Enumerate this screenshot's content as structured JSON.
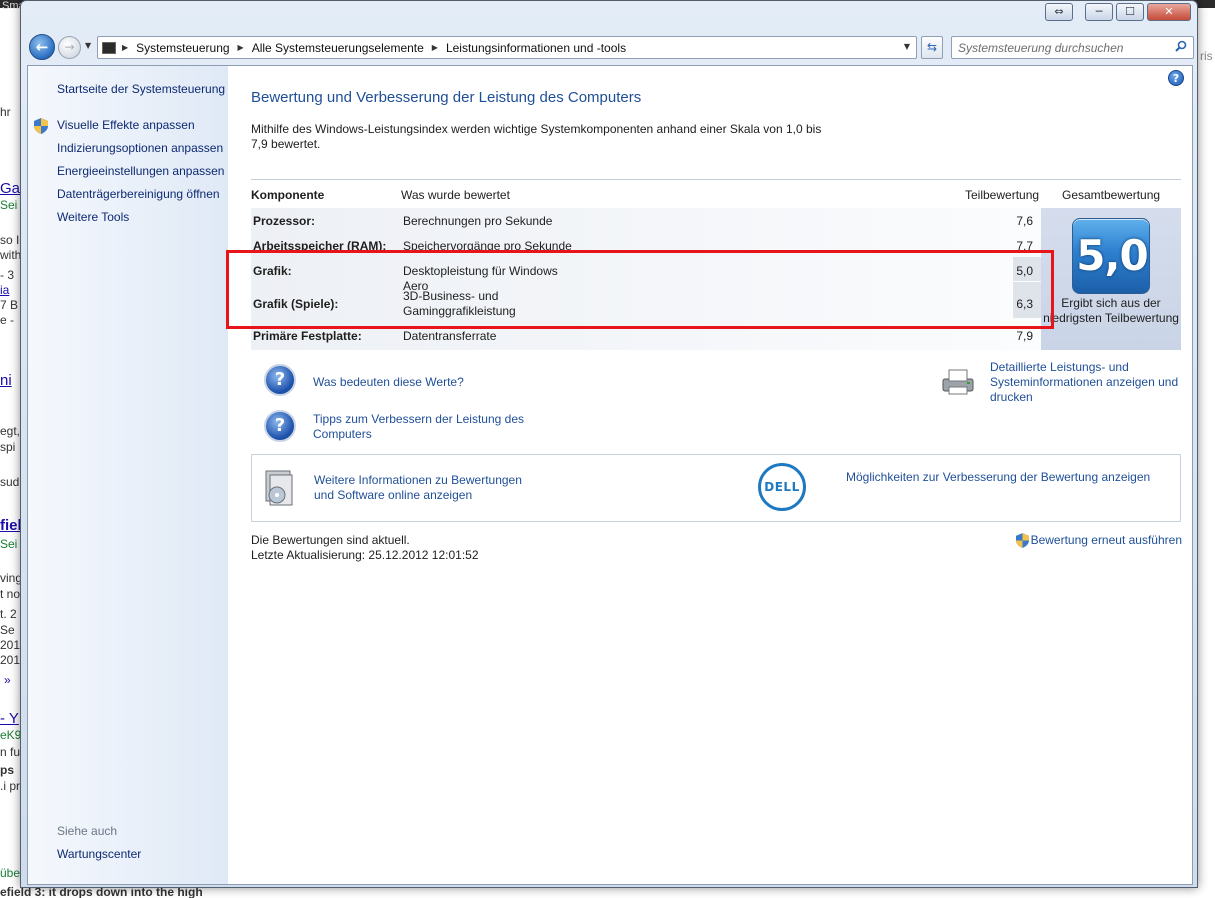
{
  "background_page": {
    "fragments": [
      "hr",
      "Ga",
      "Sei",
      "so I'",
      "with",
      "- 3",
      "ia",
      "7 B",
      "e -",
      "ni",
      "egt,",
      "spi",
      "sud",
      "fiel",
      "Sei",
      "ving",
      "t no",
      "t. 2",
      "Se",
      "201",
      "201",
      "»",
      "- Y",
      "eK9",
      "n fu",
      "ps",
      ".i pr",
      "übe",
      "efield 3: it drops down into the high"
    ],
    "right_fragment": "ris",
    "top_fragment": "Sma"
  },
  "window": {
    "controls": {
      "switch": "⇔",
      "minimize": "─",
      "maximize": "☐",
      "close": "✕"
    }
  },
  "address_bar": {
    "breadcrumbs": [
      "Systemsteuerung",
      "Alle Systemsteuerungselemente",
      "Leistungsinformationen und -tools"
    ],
    "search_placeholder": "Systemsteuerung durchsuchen"
  },
  "sidebar": {
    "home_link": "Startseite der Systemsteuerung",
    "items": [
      {
        "label": "Visuelle Effekte anpassen",
        "shield": true
      },
      {
        "label": "Indizierungsoptionen anpassen",
        "shield": false
      },
      {
        "label": "Energieeinstellungen anpassen",
        "shield": false
      },
      {
        "label": "Datenträgerbereinigung öffnen",
        "shield": false
      },
      {
        "label": "Weitere Tools",
        "shield": false
      }
    ],
    "see_also_heading": "Siehe auch",
    "see_also_items": [
      "Wartungscenter"
    ]
  },
  "main": {
    "title": "Bewertung und Verbesserung der Leistung des Computers",
    "intro": "Mithilfe des Windows-Leistungsindex werden wichtige Systemkomponenten anhand einer Skala von 1,0 bis 7,9 bewertet.",
    "table": {
      "headers": {
        "component": "Komponente",
        "what": "Was wurde bewertet",
        "subscore": "Teilbewertung",
        "total": "Gesamtbewertung"
      },
      "rows": [
        {
          "component": "Prozessor:",
          "what": "Berechnungen pro Sekunde",
          "score": "7,6"
        },
        {
          "component": "Arbeitsspeicher (RAM):",
          "what": "Speichervorgänge pro Sekunde",
          "score": "7,7"
        },
        {
          "component": "Grafik:",
          "what": "Desktopleistung für Windows Aero",
          "score": "5,0"
        },
        {
          "component": "Grafik (Spiele):",
          "what": "3D-Business- und Gaminggrafikleistung",
          "score": "6,3"
        },
        {
          "component": "Primäre Festplatte:",
          "what": "Datentransferrate",
          "score": "7,9"
        }
      ],
      "total_score": "5,0",
      "total_caption": "Ergibt sich aus der niedrigsten Teilbewertung"
    },
    "links": {
      "what_values": "Was bedeuten diese Werte?",
      "tips": "Tipps zum Verbessern der Leistung des Computers",
      "details": "Detaillierte Leistungs- und Systeminformationen anzeigen und drucken"
    },
    "offers": {
      "more_info": "Weitere Informationen zu Bewertungen und Software online anzeigen",
      "dell_logo": "DELL",
      "improve": "Möglichkeiten zur Verbesserung der Bewertung anzeigen"
    },
    "status": {
      "current": "Die Bewertungen sind aktuell.",
      "last_update": "Letzte Aktualisierung: 25.12.2012 12:01:52",
      "rerun": "Bewertung erneut ausführen"
    },
    "help_icon": "?"
  },
  "colors": {
    "link": "#1f4f99",
    "sidebar_link": "#0d2a73",
    "highlight": "#e8141a",
    "badge": "#2d7fcf"
  }
}
